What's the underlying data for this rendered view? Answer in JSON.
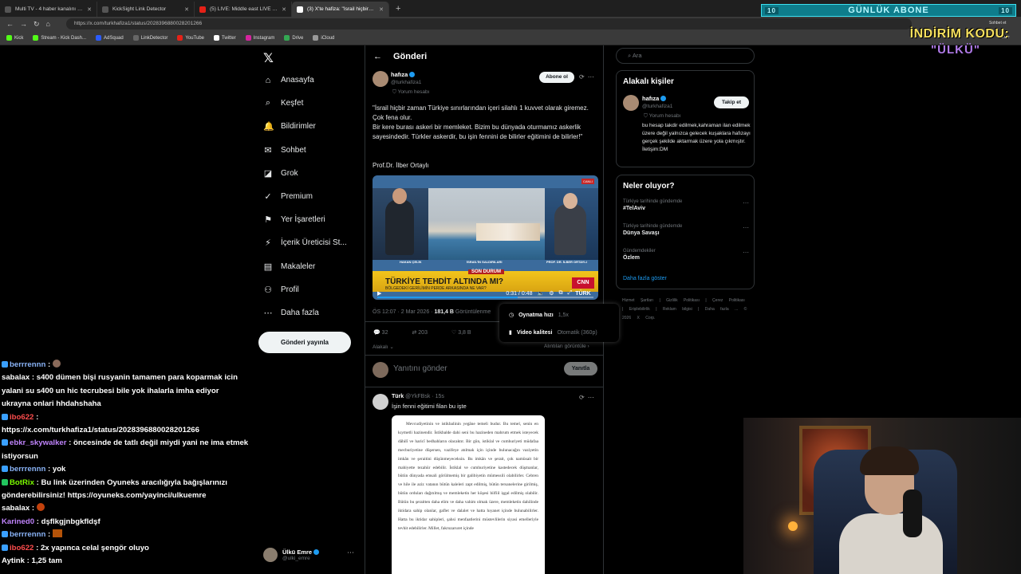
{
  "browser": {
    "tabs": [
      {
        "title": "Multi TV - 4 haber kanalını aynı",
        "color": "#3a3a3a"
      },
      {
        "title": "KickSight Link Detector",
        "color": "#3a3a3a"
      },
      {
        "title": "(5) LIVE: Middle east LIVE HD",
        "color": "#e62117"
      },
      {
        "title": "(3) X'te hafiza: \"İsrail hiçbir za",
        "color": "#ffffff"
      }
    ],
    "url": "https://x.com/turkhafiza1/status/2028396880028201266",
    "bookmarks": [
      "Kick",
      "Stream - Kick Dash...",
      "AdSquad",
      "LinkDetector",
      "YouTube",
      "Twitter",
      "Instagram",
      "Drive",
      "iCloud"
    ],
    "profile_label": "Sohbet et",
    "sidebar_label": "İlanlar"
  },
  "overlay": {
    "sub_banner": "GÜNLÜK ABONE",
    "sub_count_left": "10",
    "sub_count_right": "10",
    "promo_title": "İNDİRİM KODU:",
    "promo_code": "\"ÜLKÜ\""
  },
  "x_nav": {
    "items": [
      {
        "label": "Anasayfa",
        "icon": "⌂"
      },
      {
        "label": "Keşfet",
        "icon": "⌕"
      },
      {
        "label": "Bildirimler",
        "icon": "🔔"
      },
      {
        "label": "Sohbet",
        "icon": "✉"
      },
      {
        "label": "Grok",
        "icon": "◪"
      },
      {
        "label": "Premium",
        "icon": "✓"
      },
      {
        "label": "Yer İşaretleri",
        "icon": "⚑"
      },
      {
        "label": "İçerik Üreticisi St...",
        "icon": "⚡"
      },
      {
        "label": "Makaleler",
        "icon": "▤"
      },
      {
        "label": "Profil",
        "icon": "⚇"
      },
      {
        "label": "Daha fazla",
        "icon": "⋯"
      }
    ],
    "post_button": "Gönderi yayınla",
    "account_name": "Ülkü Emre",
    "account_handle": "@ulki_emre"
  },
  "chat": [
    {
      "user": "berrrennn",
      "color": "#8ab4f8",
      "text": ""
    },
    {
      "user": "sabalax",
      "color": "#ffffff",
      "text": "s400 dümen bişi rusyanin tamamen para koparmak icin yalani su s400 un hic tecrubesi bile yok ihalarla imha ediyor ukrayna onlari hhdahshaha"
    },
    {
      "user": "ibo622",
      "color": "#ff4d4d",
      "text": ""
    },
    {
      "user": "",
      "color": "#ffffff",
      "text": "https://x.com/turkhafiza1/status/2028396880028201266"
    },
    {
      "user": "ebkr_skywalker",
      "color": "#c084fc",
      "text": "öncesinde de tatlı değil miydi yani ne ima etmek istiyorsun"
    },
    {
      "user": "berrrennn",
      "color": "#8ab4f8",
      "text": "yok"
    },
    {
      "user": "BotRix",
      "color": "#7cfc00",
      "text": "Bu link üzerinden Oyuneks aracılığıyla bağışlarınızı gönderebilirsiniz! https://oyuneks.com/yayinci/ulkuemre"
    },
    {
      "user": "sabalax",
      "color": "#ffffff",
      "text": ""
    },
    {
      "user": "Karined0",
      "color": "#c084fc",
      "text": "dşflkgjnbgkfldşf"
    },
    {
      "user": "berrrennn",
      "color": "#8ab4f8",
      "text": ""
    },
    {
      "user": "ibo622",
      "color": "#ff4d4d",
      "text": "2x yapınca celal şengör oluyo"
    },
    {
      "user": "Aytink",
      "color": "#ffffff",
      "text": "1,25 tam"
    }
  ],
  "post": {
    "header_title": "Gönderi",
    "author": "hafıza",
    "handle": "@turkhafiza1",
    "label": "Yorum hesabı",
    "subscribe": "Abone ol",
    "text": "\"İsrail hiçbir zaman Türkiye sınırlarından içeri silahlı 1 kuvvet olarak giremez. Çok fena olur.\nBir kere burası askeri bir memleket. Bizim bu dünyada  oturmamız askerlik sayesindedir. Türkler askerdir, bu işin fennini de bilirler eğitimini de bilirler!\"",
    "signature": "Prof.Dr. İlber Ortaylı",
    "video": {
      "live_tag": "CANLI",
      "left_name": "HAKAN ÇELİK",
      "middle_caption": "İSRAİL'İN SALDIRILARI",
      "right_name": "PROF. DR. İLBER ORTAYLI",
      "breaking": "SON DURUM",
      "headline": "TÜRKİYE TEHDİT ALTINDA MI?",
      "subline": "BÖLGEDEKİ GERİLİMİN PERDE ARKASINDA NE VAR?",
      "channel": "CNN TÜRK",
      "time": "0:31 / 0:48",
      "progress": 0.65
    },
    "meta_time": "ÖS 12:07 · 2 Mar 2026 · ",
    "views": "181,4 B",
    "views_label": "Görüntülenme",
    "replies": "32",
    "reposts": "203",
    "likes": "3,8 B",
    "relevant": "Alakalı ⌄",
    "all_views": "Alıntıları görüntüle ›",
    "reply_placeholder": "Yanıtını gönder",
    "reply_button": "Yanıtla"
  },
  "settings_popup": {
    "speed_label": "Oynatma hızı",
    "speed_value": "1,5x",
    "quality_label": "Video kalitesi",
    "quality_value": "Otomatik (360p)"
  },
  "reply2": {
    "author": "Türk",
    "handle": "@YkFBsk",
    "time": "15s",
    "text": "İşin fenni eğitimi filan bu işte",
    "doc_text": "Mevcudiyetinin ve istikbalinin yegâne temeli budur. Bu temel, senin en kıymetli hazinendir. İstikbalde dahi seni bu hazineden mahrum etmek isteyecek dâhilî ve haricî bedhahların olacaktır. Bir gün, istiklal ve cumhuriyeti müdafaa mecburiyetine düşersen, vazifeye atılmak için içinde bulunacağın vaziyetin imkân ve şeraitini düşünmeyeceksin. Bu imkân ve şerait, çok namüsait bir mahiyette tezahür edebilir. İstiklal ve cumhuriyetine kastedecek düşmanlar, bütün dünyada emsali görülmemiş bir galibiyetin mümessili olabilirler. Cebren ve hile ile aziz vatanın bütün kaleleri zapt edilmiş, bütün tersanelerine girilmiş, bütün orduları dağıtılmış ve memleketin her köşesi bilfiil işgal edilmiş olabilir. Bütün bu şeraitten daha elim ve daha vahim olmak üzere, memleketin dahilinde iktidara sahip olanlar, gaflet ve dalalet ve hatta hıyanet içinde bulunabilirler. Hatta bu iktidar sahipleri, şahsi menfaatlerini müstevlilerin siyasi emelleriyle tevhit edebilirler. Millet, fakruzaruret içinde"
  },
  "right": {
    "search_placeholder": "Ara",
    "related_title": "Alakalı kişiler",
    "rp_name": "hafıza",
    "rp_handle": "@turkhafiza1",
    "rp_label": "Yorum hesabı",
    "follow": "Takip et",
    "rp_bio": "bu hesap takdir edilmek,kahraman ilan edilmek üzere değil yalnızca gelecek kuşaklara hafızayı gerçek şekilde aktarmak üzere yola çıkmıştır. İletişim:DM",
    "trends_title": "Neler oluyor?",
    "trends": [
      {
        "context": "Türkiye tarihinde gündemde",
        "topic": "#TelAviv"
      },
      {
        "context": "Türkiye tarihinde gündemde",
        "topic": "Dünya Savaşı"
      },
      {
        "context": "Gündemdekiler",
        "topic": "Özlem"
      }
    ],
    "show_more": "Daha fazla göster",
    "footer": "Hizmet Şartları | Gizlilik Politikası | Çerez Politikası | Erişilebilirlik | Reklam bilgisi | Daha fazla ... © 2026 X Corp."
  }
}
